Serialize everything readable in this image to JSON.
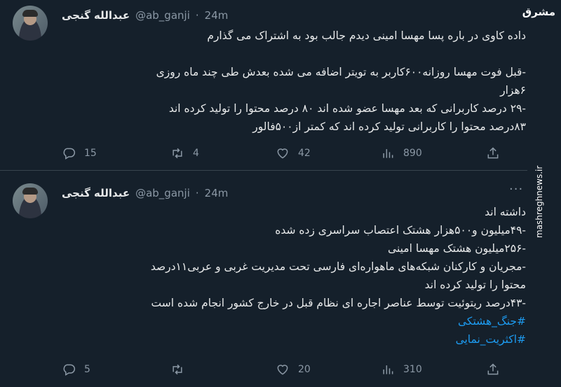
{
  "tweets": [
    {
      "author_name": "عبدالله گنجی",
      "handle": "@ab_ganji",
      "time": "24m",
      "lines": [
        "داده کاوی در باره پسا مهسا امینی دیدم جالب بود به اشتراک می گذارم",
        "",
        "-قبل فوت مهسا روزانه۶۰۰کاربر به تویتر اضافه می شده بعدش طی چند ماه روزی",
        "۶هزار",
        "-۲۹ درصد کاربرانی که بعد مهسا عضو شده اند ۸۰ درصد محتوا را تولید کرده اند",
        "۸۳درصد محتوا را کاربرانی تولید کرده اند که کمتر از۵۰۰فالور"
      ],
      "hashtags": [],
      "stats": {
        "replies": "15",
        "retweets": "4",
        "likes": "42",
        "views": "890"
      }
    },
    {
      "author_name": "عبدالله گنجی",
      "handle": "@ab_ganji",
      "time": "24m",
      "lines": [
        "داشته اند",
        "-۴۹میلیون و۵۰۰هزار هشتک اعتصاب سراسری زده شده",
        "-۲۵۶میلیون هشتک مهسا امینی",
        "-مجریان و کارکنان شبکه‌های ماهواره‌ای فارسی تحت مدیریت غربی و عربی۱۱درصد",
        "محتوا را تولید کرده اند",
        "-۴۳درصد ریتوئیت توسط عناصر اجاره ای نظام قبل در خارج کشور انجام شده است"
      ],
      "hashtags": [
        "#جنگ_هشتکی",
        "#اکثریت_نمایی"
      ],
      "stats": {
        "replies": "5",
        "retweets": "",
        "likes": "20",
        "views": "310"
      }
    }
  ],
  "watermark": {
    "logo": "مشرق",
    "url": "mashreghnews.ir"
  },
  "colors": {
    "background": "#15202b",
    "text": "#e7e9ea",
    "muted": "#8b98a5",
    "link": "#1d9bf0",
    "divider": "#38444d"
  },
  "icons": {
    "reply": "reply-icon",
    "retweet": "retweet-icon",
    "like": "heart-icon",
    "views": "views-icon",
    "share": "share-icon",
    "more": "more-icon"
  }
}
